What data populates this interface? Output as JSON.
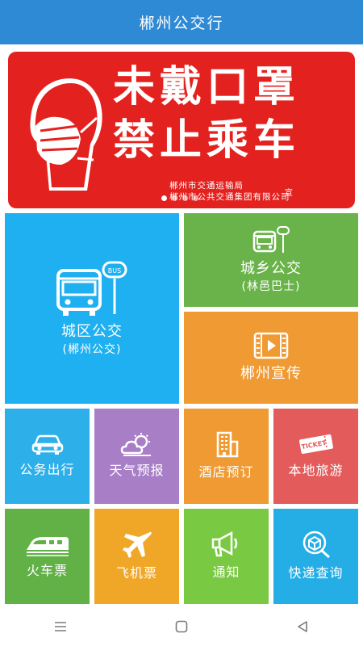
{
  "app": {
    "title": "郴州公交行"
  },
  "banner": {
    "line1": "未戴口罩",
    "line2": "禁止乘车",
    "org1": "郴州市交通运输局",
    "org2": "郴州市公共交通集团有限公司",
    "org_suffix": "宣",
    "slide_count": 4,
    "active_slide": 1
  },
  "tiles": {
    "city": {
      "label": "城区公交",
      "sub": "(郴州公交)",
      "icon": "bus-stop-icon",
      "color": "#1eb0f0"
    },
    "rural": {
      "label": "城乡公交",
      "sub": "(林邑巴士)",
      "icon": "bus-stop-icon",
      "color": "#6ab34a"
    },
    "promo": {
      "label": "郴州宣传",
      "icon": "film-play-icon",
      "color": "#f09a33"
    },
    "official": {
      "label": "公务出行",
      "icon": "car-icon",
      "color": "#2db0ea"
    },
    "weather": {
      "label": "天气预报",
      "icon": "sun-cloud-icon",
      "color": "#a87ec6"
    },
    "hotel": {
      "label": "酒店预订",
      "icon": "building-icon",
      "color": "#f09a33"
    },
    "travel": {
      "label": "本地旅游",
      "icon": "ticket-icon",
      "color": "#e45b5b"
    },
    "train": {
      "label": "火车票",
      "icon": "train-icon",
      "color": "#61b146"
    },
    "plane": {
      "label": "飞机票",
      "icon": "airplane-icon",
      "color": "#f0a728"
    },
    "notice": {
      "label": "通知",
      "icon": "megaphone-icon",
      "color": "#7ac943"
    },
    "express": {
      "label": "快递查询",
      "icon": "package-search-icon",
      "color": "#25aee6"
    }
  },
  "banner_icon_text": "BUS",
  "navbar": {
    "items": [
      "menu-icon",
      "home-square-icon",
      "back-triangle-icon"
    ]
  }
}
